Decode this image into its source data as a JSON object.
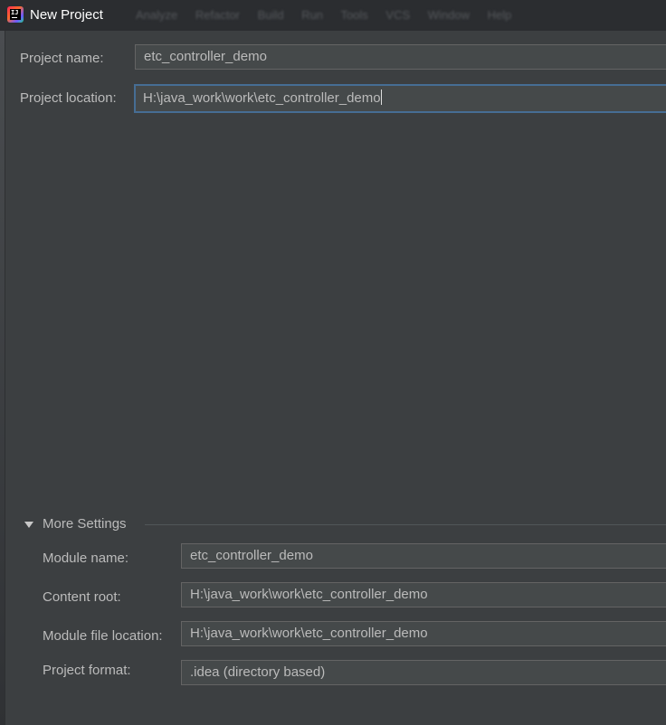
{
  "window": {
    "title": "New Project",
    "background_menu": [
      "Analyze",
      "Refactor",
      "Build",
      "Run",
      "Tools",
      "VCS",
      "Window",
      "Help"
    ]
  },
  "form": {
    "project_name_label": "Project name:",
    "project_name_value": "etc_controller_demo",
    "project_location_label": "Project location:",
    "project_location_value": "H:\\java_work\\work\\etc_controller_demo"
  },
  "more_settings": {
    "title": "More Settings",
    "expanded": true,
    "module_name_label": "Module name:",
    "module_name_value": "etc_controller_demo",
    "content_root_label": "Content root:",
    "content_root_value": "H:\\java_work\\work\\etc_controller_demo",
    "module_file_label": "Module file location:",
    "module_file_value": "H:\\java_work\\work\\etc_controller_demo",
    "project_format_label": "Project format:",
    "project_format_value": ".idea (directory based)"
  },
  "colors": {
    "background": "#3c3f41",
    "field_background": "#45494a",
    "focus_border": "#466d94",
    "text": "#bbbbbb"
  }
}
